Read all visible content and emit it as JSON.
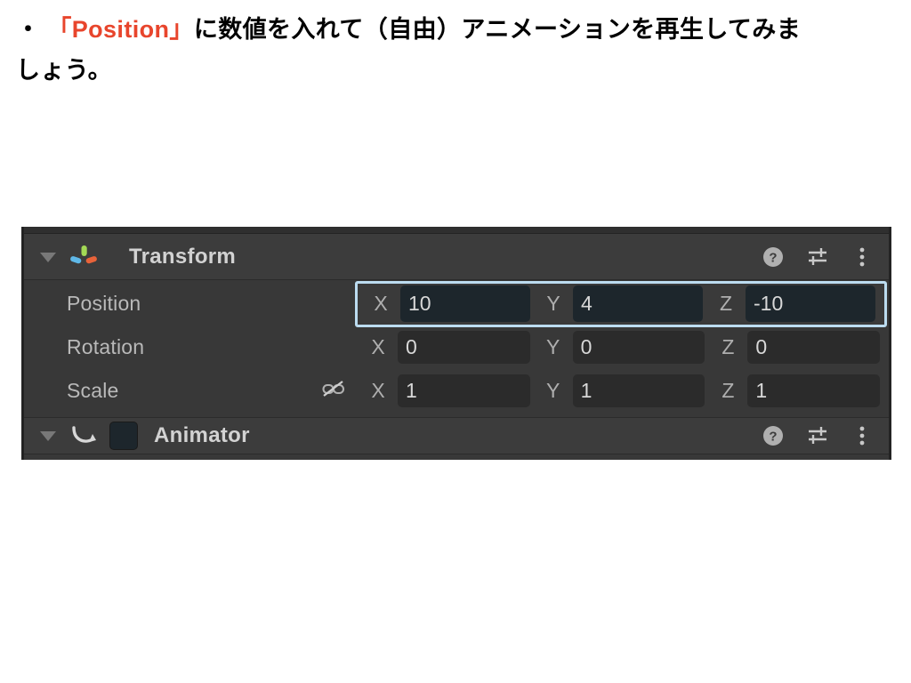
{
  "slide": {
    "caption": {
      "bullet": "・",
      "highlight": "「Position」",
      "rest_line1": "に数値を入れて（自由）アニメーションを再生してみま",
      "line2": "しょう。",
      "highlight_color": "#e8452c",
      "text_color": "#000000"
    }
  },
  "inspector": {
    "components": [
      {
        "title": "Transform",
        "icon": "transform-gizmo-icon",
        "foldout": "expanded",
        "tools": [
          {
            "name": "help-icon",
            "glyph": "?"
          },
          {
            "name": "settings-sliders-icon",
            "glyph": "sliders"
          },
          {
            "name": "more-menu-icon",
            "glyph": "kebab"
          }
        ],
        "rows": [
          {
            "label": "Position",
            "focused": true,
            "link": false,
            "axes": [
              {
                "axis": "X",
                "value": "10"
              },
              {
                "axis": "Y",
                "value": "4"
              },
              {
                "axis": "Z",
                "value": "-10"
              }
            ]
          },
          {
            "label": "Rotation",
            "focused": false,
            "link": false,
            "axes": [
              {
                "axis": "X",
                "value": "0"
              },
              {
                "axis": "Y",
                "value": "0"
              },
              {
                "axis": "Z",
                "value": "0"
              }
            ]
          },
          {
            "label": "Scale",
            "focused": false,
            "link": true,
            "link_icon": "broken-link-icon",
            "axes": [
              {
                "axis": "X",
                "value": "1"
              },
              {
                "axis": "Y",
                "value": "1"
              },
              {
                "axis": "Z",
                "value": "1"
              }
            ]
          }
        ]
      },
      {
        "title": "Animator",
        "icon": "animator-icon",
        "foldout": "expanded",
        "enabled": false,
        "clipped": true,
        "tools": [
          {
            "name": "help-icon",
            "glyph": "?"
          },
          {
            "name": "settings-sliders-icon",
            "glyph": "sliders"
          },
          {
            "name": "more-menu-icon",
            "glyph": "kebab"
          }
        ]
      }
    ],
    "colors": {
      "panel_bg": "#383838",
      "header_bg": "#3c3c3c",
      "field_bg": "#2b2b2b",
      "field_bg_focused": "#1d262c",
      "focus_border": "#bcdcf0",
      "label_text": "#b9b9b9"
    }
  }
}
